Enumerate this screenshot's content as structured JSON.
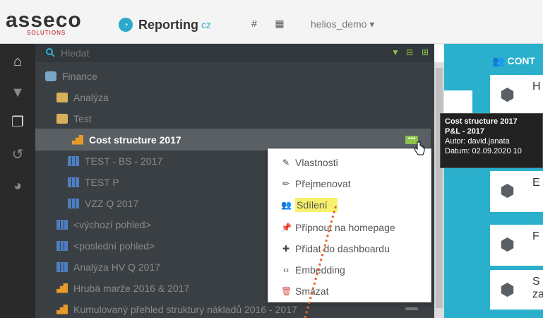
{
  "topbar": {
    "logo_text": "asseco",
    "logo_subtext": "SOLUTIONS",
    "brand_name": "Reporting",
    "brand_sub": "cz",
    "hash_icon": "hash-icon",
    "grid_icon": "grid-icon",
    "database_select": "helios_demo ▾"
  },
  "iconbar": {
    "items": [
      "home-icon",
      "filter-icon",
      "copy-icon",
      "history-icon",
      "dashboard-icon"
    ]
  },
  "tree": {
    "search_placeholder": "Hledat",
    "items": [
      {
        "label": "Finance",
        "icon": "finance-icon"
      },
      {
        "label": "Analýza",
        "icon": "folder-icon"
      },
      {
        "label": "Test",
        "icon": "folder-open-icon"
      },
      {
        "label": "Cost structure 2017",
        "icon": "bar-chart-icon",
        "selected": true
      },
      {
        "label": "TEST - BS - 2017",
        "icon": "table-icon"
      },
      {
        "label": "TEST P",
        "icon": "table-icon"
      },
      {
        "label": "VZZ Q 2017",
        "icon": "table-icon"
      },
      {
        "label": "<výchozí pohled>",
        "icon": "table-icon"
      },
      {
        "label": "<poslední pohled>",
        "icon": "table-icon"
      },
      {
        "label": "Analýza HV Q 2017",
        "icon": "table-icon"
      },
      {
        "label": "Hrubá marže 2016 & 2017",
        "icon": "bar-chart-icon"
      },
      {
        "label": "Kumulovaný přehled struktury nákladů 2016 - 2017",
        "icon": "bar-chart-icon"
      }
    ]
  },
  "context_menu": {
    "items": [
      {
        "label": "Vlastnosti",
        "icon": "edit-icon"
      },
      {
        "label": "Přejmenovat",
        "icon": "pencil-icon"
      },
      {
        "label": "Sdílení",
        "icon": "share-users-icon",
        "highlighted": true
      },
      {
        "label": "Připnout na homepage",
        "icon": "pin-icon"
      },
      {
        "label": "Přidat do dashboardu",
        "icon": "plus-icon"
      },
      {
        "label": "Embedding",
        "icon": "code-icon"
      },
      {
        "label": "Smazat",
        "icon": "trash-icon"
      }
    ]
  },
  "right": {
    "header": "CONT",
    "tiles": [
      "H",
      "E",
      "F",
      "S za"
    ]
  },
  "tooltip": {
    "title": "Cost structure 2017",
    "subtitle": "P&L - 2017",
    "author": "Autor: david.janata",
    "date": "Datum: 02.09.2020 10"
  },
  "colors": {
    "accent": "#2ab0cc",
    "green": "#8bc34a",
    "highlight": "#f7f26b",
    "annotation": "#e8642a"
  }
}
